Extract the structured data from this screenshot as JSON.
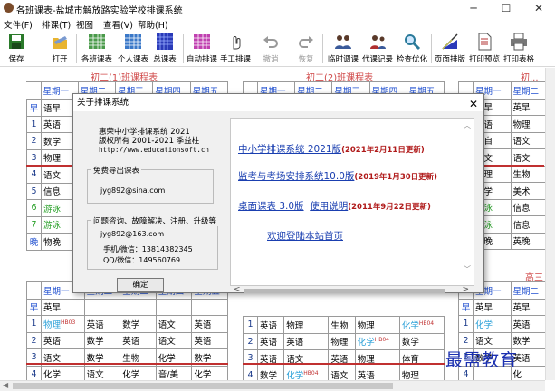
{
  "window": {
    "title": "各班课表-盐城市解放路实验学校排课系统",
    "icon": "app-icon"
  },
  "menu": [
    "文件(F)",
    "排课(T)",
    "视图",
    "查看(V)",
    "帮助(H)"
  ],
  "toolbar": [
    {
      "label": "保存",
      "icon": "save-icon"
    },
    {
      "label": "打开",
      "icon": "open-icon"
    },
    {
      "label": "各班课表",
      "icon": "class-schedule-icon"
    },
    {
      "label": "个人课表",
      "icon": "personal-schedule-icon"
    },
    {
      "label": "总课表",
      "icon": "master-schedule-icon"
    },
    {
      "label": "自动排课",
      "icon": "auto-schedule-icon"
    },
    {
      "label": "手工排课",
      "icon": "hand-icon"
    },
    {
      "label": "撤消",
      "icon": "undo-icon"
    },
    {
      "label": "恢复",
      "icon": "redo-icon"
    },
    {
      "label": "临时调课",
      "icon": "people-icon"
    },
    {
      "label": "代课记录",
      "icon": "substitute-icon"
    },
    {
      "label": "检查优化",
      "icon": "magnifier-icon"
    },
    {
      "label": "页面排版",
      "icon": "layout-icon"
    },
    {
      "label": "打印预览",
      "icon": "print-preview-icon"
    },
    {
      "label": "打印表格",
      "icon": "printer-icon"
    }
  ],
  "panels": {
    "p1": {
      "title": "初二(1)班课程表",
      "days": [
        "星期一",
        "星期二",
        "星期三",
        "星期四",
        "星期五"
      ],
      "rows": [
        [
          "早",
          "语早",
          "",
          "",
          "",
          ""
        ],
        [
          "1",
          "英语",
          "",
          "",
          "",
          ""
        ],
        [
          "2",
          "数学",
          "",
          "",
          "",
          ""
        ],
        [
          "3",
          "物理",
          "",
          "",
          "",
          ""
        ],
        [
          "4",
          "语文",
          "",
          "",
          "",
          ""
        ],
        [
          "5",
          "信息",
          "",
          "",
          "",
          ""
        ],
        [
          "6",
          "游泳",
          "",
          "",
          "",
          ""
        ],
        [
          "7",
          "游泳",
          "",
          "",
          "",
          ""
        ],
        [
          "晚",
          "物晚",
          "",
          "",
          "",
          ""
        ]
      ]
    },
    "p2": {
      "title": "初二(2)班课程表",
      "days": [
        "星期一",
        "星期二",
        "星期三",
        "星期四",
        "星期五"
      ]
    },
    "p3": {
      "title": "初...",
      "days": [
        "星期一",
        "星期二"
      ],
      "rows": [
        [
          "早",
          "英早",
          "英早"
        ],
        [
          "1",
          "英语",
          "物理"
        ],
        [
          "2",
          "语自",
          "语文"
        ],
        [
          "3",
          "语文",
          "语文"
        ],
        [
          "4",
          "物理",
          "生物"
        ],
        [
          "5",
          "数学",
          "美术"
        ],
        [
          "6",
          "游泳",
          "信息"
        ],
        [
          "7",
          "游泳",
          "信息"
        ],
        [
          "晚",
          "物晚",
          "英晚"
        ]
      ]
    },
    "p4": {
      "title": "",
      "days": [
        "星期一",
        "星期二",
        "星期三",
        "星期四",
        "星期五"
      ],
      "rows": [
        [
          "早",
          "英早",
          "",
          "",
          "",
          ""
        ],
        [
          "1",
          "物理",
          "英语",
          "数学",
          "语文",
          "英语"
        ],
        [
          "2",
          "英语",
          "数学",
          "英语",
          "语文",
          "英语"
        ],
        [
          "3",
          "语文",
          "数学",
          "生物",
          "化学",
          "数学"
        ],
        [
          "4",
          "化学",
          "语文",
          "化学",
          "音/美",
          "化学"
        ]
      ]
    },
    "p5": {
      "title": "",
      "rows": [
        [
          "1",
          "英语",
          "物理",
          "生物",
          "物理",
          "化学"
        ],
        [
          "2",
          "英语",
          "英语",
          "物理",
          "化学",
          "数学"
        ],
        [
          "3",
          "英语",
          "语文",
          "英语",
          "物理",
          "体育"
        ],
        [
          "4",
          "数学",
          "化学",
          "语文",
          "英语",
          "物理"
        ]
      ]
    },
    "p6": {
      "title": "高三",
      "days": [
        "星期一",
        "星期二"
      ],
      "rows": [
        [
          "早",
          "英早",
          "英早"
        ],
        [
          "1",
          "化学",
          "英语"
        ],
        [
          "2",
          "语文",
          "数学"
        ],
        [
          "3",
          "数学",
          "英语"
        ],
        [
          "4",
          "",
          "化"
        ]
      ]
    }
  },
  "dialog": {
    "title": "关于排课系统",
    "close": "✕",
    "product": "惠荣中小学排课系统 2021",
    "copyright": "版权所有  2001-2021  季益柱",
    "website": "http://www.educationsoft.cn",
    "group1_label": "免费导出课表",
    "group1_email": "jyg892@sina.com",
    "group2_label": "问题咨询、故障解决、注册、升级等",
    "group2_email": "jyg892@163.com",
    "phone": "手机/微信：13814382345",
    "qq": "QQ/微信：149560769",
    "ok": "确定",
    "links": [
      {
        "text": "中小学排课系统 2021版",
        "date": "(2021年2月11日更新)"
      },
      {
        "text": "监考与考场安排系统10.0版",
        "date": "(2019年1月30日更新)"
      },
      {
        "text": "桌面课表 3.0版",
        "text2": "使用说明",
        "date": "(2011年9月22日更新)"
      },
      {
        "text": "欢迎登陆本站首页"
      }
    ]
  },
  "watermark": "最需教育",
  "marks": {
    "hb03": "HB03",
    "hb04": "HB04"
  }
}
